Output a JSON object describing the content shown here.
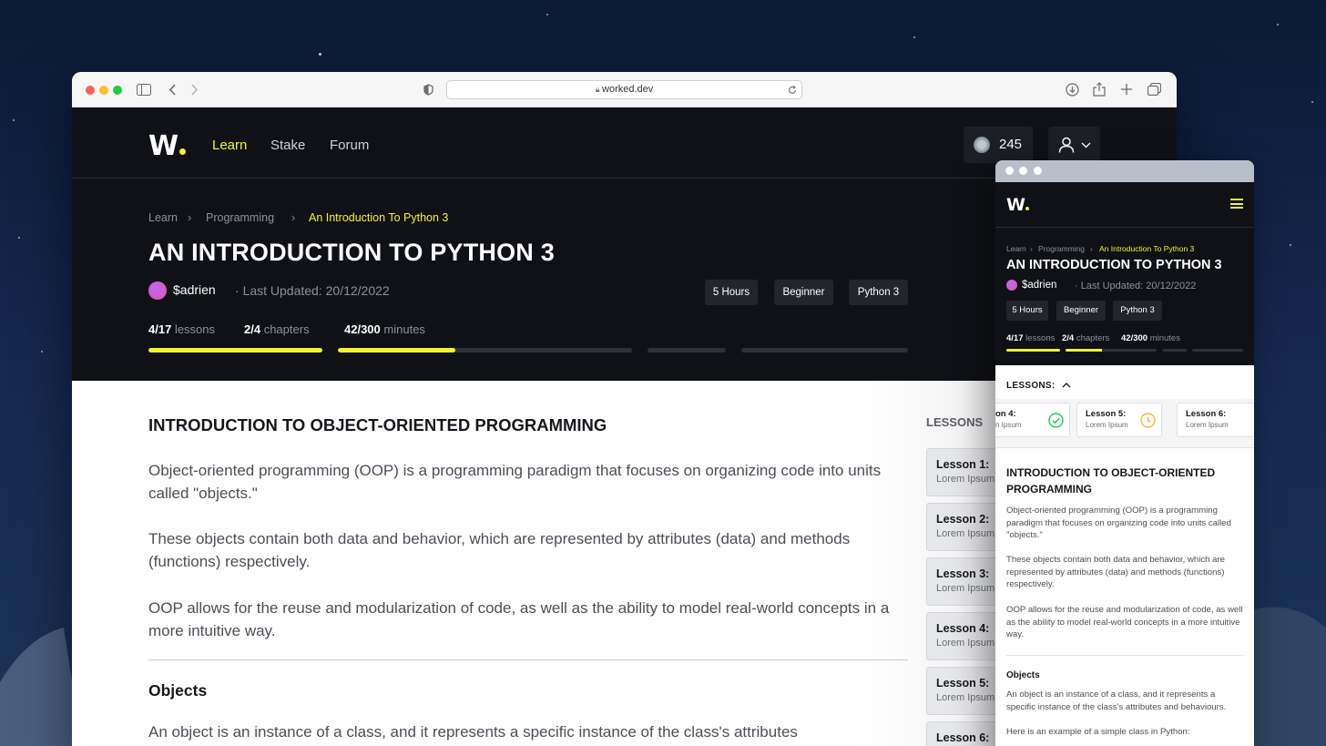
{
  "browser": {
    "url": "worked.dev"
  },
  "site": {
    "logo": "W",
    "nav": [
      "Learn",
      "Stake",
      "Forum"
    ],
    "coins": "245"
  },
  "breadcrumb": [
    "Learn",
    "Programming",
    "An Introduction To Python 3"
  ],
  "course": {
    "title": "AN INTRODUCTION TO PYTHON 3",
    "author": "$adrien",
    "updated": "Last Updated: 20/12/2022",
    "tags": [
      "5 Hours",
      "Beginner",
      "Python 3"
    ],
    "lessons_done": "4/17",
    "lessons_label": "lessons",
    "chapters_done": "2/4",
    "chapters_label": "chapters",
    "minutes_done": "42/300",
    "minutes_label": "minutes",
    "progress_segments": [
      1.0,
      0.4,
      0.0,
      0.0
    ]
  },
  "article": {
    "heading": "INTRODUCTION TO OBJECT-ORIENTED PROGRAMMING",
    "p1": "Object-oriented programming (OOP) is a programming paradigm that focuses on organizing code into units called \"objects.\"",
    "p2": "These objects contain both data and behavior, which are represented by attributes (data) and methods (functions) respectively.",
    "p3": "OOP allows for the reuse and modularization of code, as well as the ability to model real-world concepts in a more intuitive way.",
    "h2": "Objects",
    "p4": "An object is an instance of a class, and it represents a specific instance of the class's attributes",
    "p4_full": "An object is an instance of a class, and it represents a specific instance of the class's attributes and behaviours.",
    "p5": "Here is an example of a simple class in Python:"
  },
  "lessons_panel": {
    "title": "LESSONS",
    "mini_title": "LESSONS:",
    "items": [
      {
        "label": "Lesson 1:",
        "sub": "Lorem Ipsum"
      },
      {
        "label": "Lesson 2:",
        "sub": "Lorem Ipsum"
      },
      {
        "label": "Lesson 3:",
        "sub": "Lorem Ipsum"
      },
      {
        "label": "Lesson 4:",
        "sub": "Lorem Ipsum"
      },
      {
        "label": "Lesson 5:",
        "sub": "Lorem Ipsum"
      },
      {
        "label": "Lesson 6:",
        "sub": "Lorem Ipsum"
      }
    ],
    "mini_partial_label": "on 4:",
    "mini_partial_sub": "n Ipsum"
  },
  "colors": {
    "accent": "#f2f52c",
    "dark": "#0f1116",
    "done": "#22c55e",
    "pending": "#f5b82e"
  }
}
